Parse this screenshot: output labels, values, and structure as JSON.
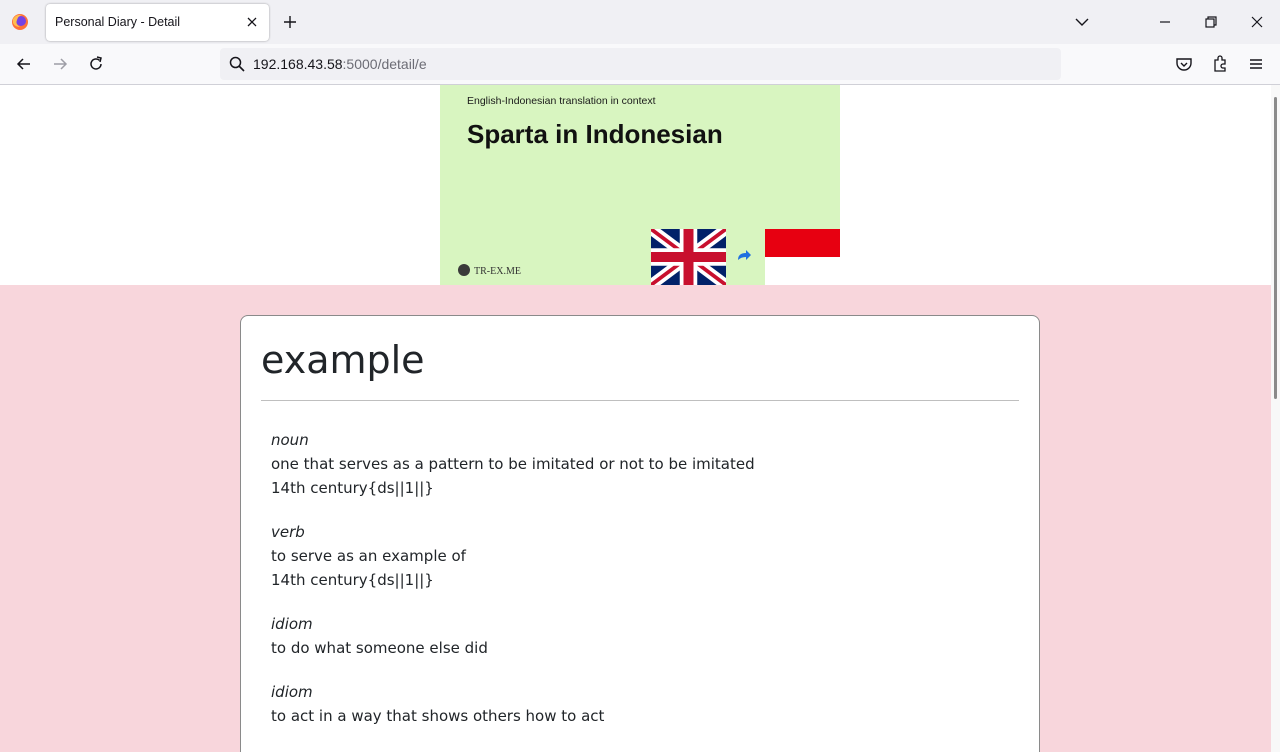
{
  "browser": {
    "tab_title": "Personal Diary - Detail",
    "url_host": "192.168.43.58",
    "url_path": ":5000/detail/e"
  },
  "hero": {
    "subtitle": "English-Indonesian translation in context",
    "title": "Sparta in Indonesian",
    "logo_text": "TR-EX.ME"
  },
  "entry": {
    "word": "example",
    "definitions": [
      {
        "pos": "noun",
        "lines": [
          "one that serves as a pattern to be imitated or not to be imitated",
          "14th century{ds||1||}"
        ]
      },
      {
        "pos": "verb",
        "lines": [
          "to serve as an example of",
          "14th century{ds||1||}"
        ]
      },
      {
        "pos": "idiom",
        "lines": [
          "to do what someone else did"
        ]
      },
      {
        "pos": "idiom",
        "lines": [
          "to act in a way that shows others how to act"
        ]
      }
    ]
  },
  "colors": {
    "page_background": "#f8d6dc",
    "hero_background": "#d8f5c0",
    "indonesia_red": "#e70011"
  }
}
